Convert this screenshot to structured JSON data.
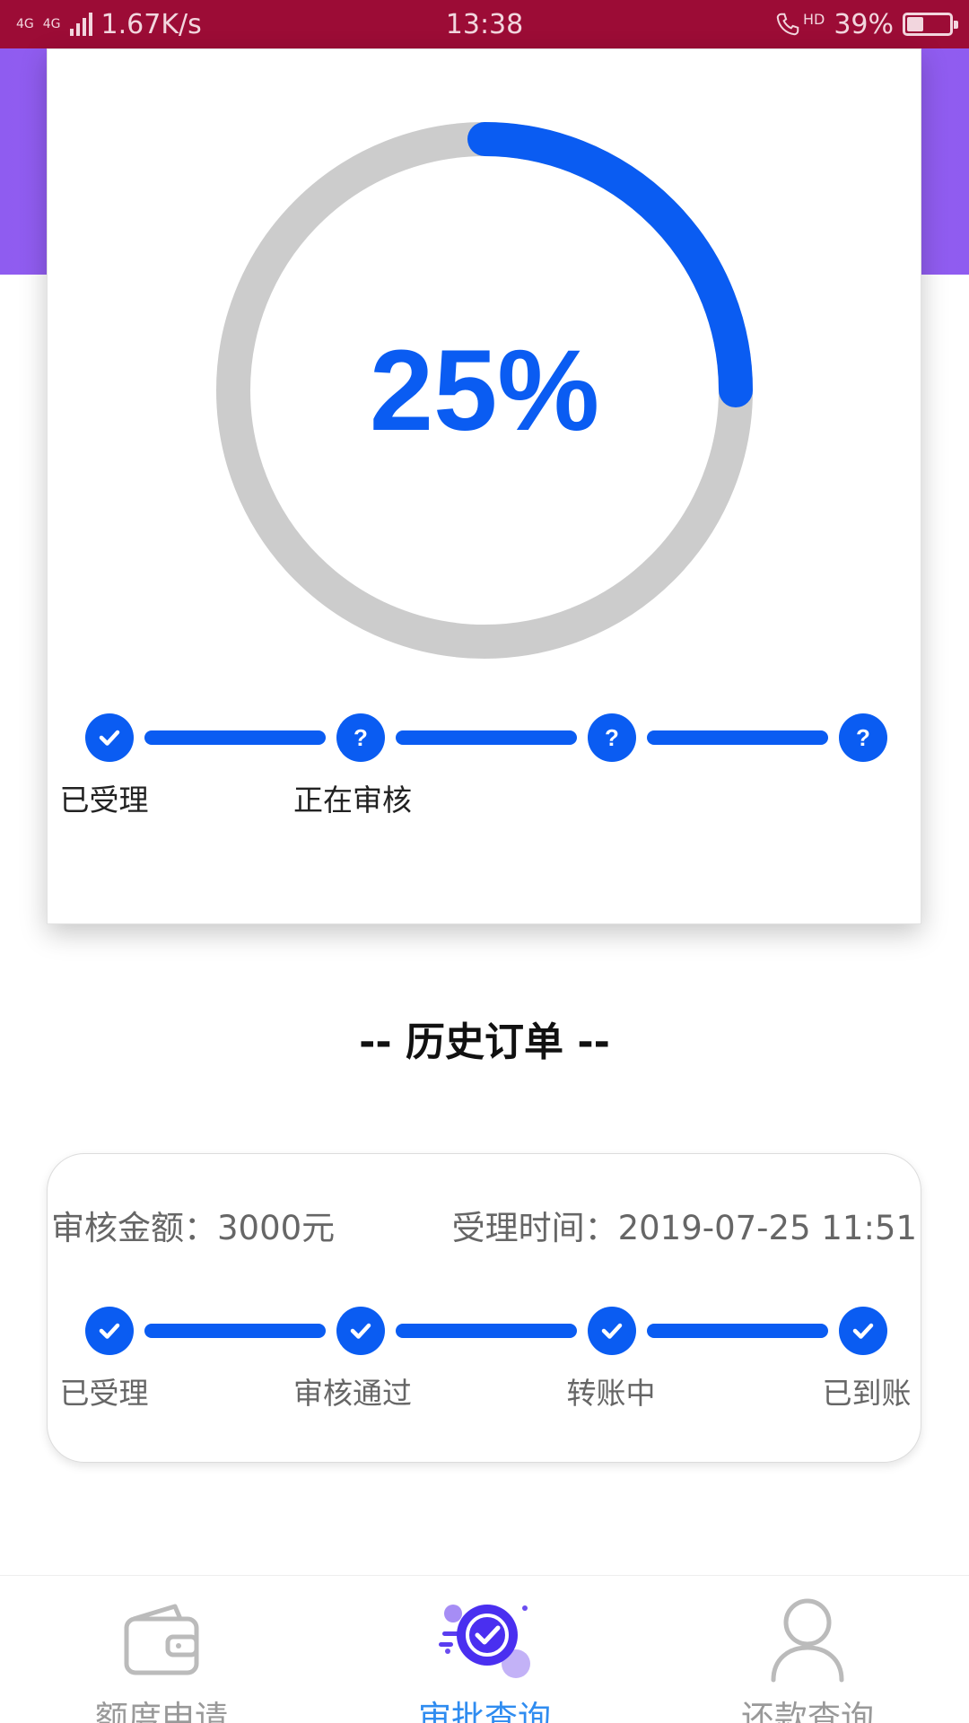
{
  "status_bar": {
    "network_a": "4G",
    "network_b": "4G",
    "speed": "1.67K/s",
    "time": "13:38",
    "hd": "HD",
    "battery_text": "39%",
    "battery_level": 0.39
  },
  "progress": {
    "percent_text": "25%",
    "fraction": 0.25,
    "steps": [
      {
        "state": "done",
        "label": "已受理"
      },
      {
        "state": "pending",
        "label": "正在审核"
      },
      {
        "state": "pending",
        "label": ""
      },
      {
        "state": "pending",
        "label": ""
      }
    ]
  },
  "history": {
    "title": "-- 历史订单 --",
    "orders": [
      {
        "amount_label": "审核金额：3000元",
        "time_label": "受理时间：2019-07-25 11:51",
        "steps": [
          {
            "state": "done",
            "label": "已受理"
          },
          {
            "state": "done",
            "label": "审核通过"
          },
          {
            "state": "done",
            "label": "转账中"
          },
          {
            "state": "done",
            "label": "已到账"
          }
        ]
      }
    ]
  },
  "nav": {
    "items": [
      {
        "label": "额度申请",
        "icon": "wallet-icon",
        "active": false
      },
      {
        "label": "审批查询",
        "icon": "approval-check-icon",
        "active": true
      },
      {
        "label": "还款查询",
        "icon": "user-icon",
        "active": false
      }
    ]
  },
  "colors": {
    "accent": "#0a5cf2",
    "status_bar": "#9c0c36",
    "header_purple": "#9a60ef",
    "ring_track": "#cccccc",
    "nav_active": "#2f8cf0"
  }
}
